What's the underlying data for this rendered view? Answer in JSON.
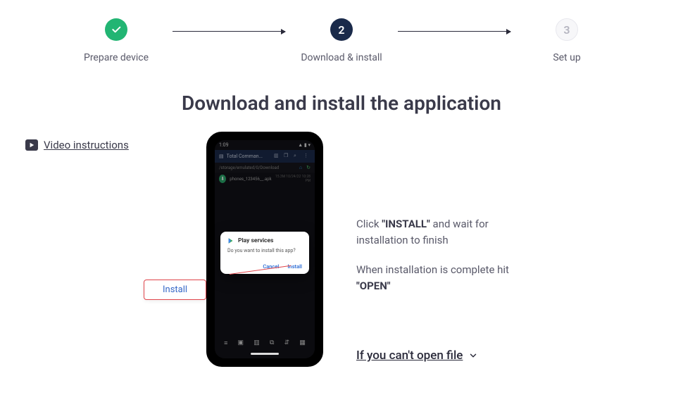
{
  "stepper": {
    "steps": [
      {
        "label": "Prepare device",
        "state": "done"
      },
      {
        "num": "2",
        "label": "Download & install",
        "state": "active"
      },
      {
        "num": "3",
        "label": "Set up",
        "state": "pending"
      }
    ]
  },
  "title": "Download and install the application",
  "video_link_label": "Video instructions",
  "phone": {
    "time": "1:09",
    "app_title": "Total Comman...",
    "path": "/storage/emulated/0/Download",
    "file": {
      "name": "phones_123456__.apk",
      "meta": "15.3M 10/24/22 10:28 PM"
    },
    "popup": {
      "title": "Play services",
      "message": "Do you want to install this app?",
      "cancel": "Cancel",
      "install": "Install"
    }
  },
  "callout_label": "Install",
  "instructions": {
    "p1_pre": "Click ",
    "p1_bold": "\"INSTALL\"",
    "p1_post": " and wait for installation to finish",
    "p2_pre": "When installation is complete hit ",
    "p2_bold": "\"OPEN\""
  },
  "open_file_label": "If you can't open file"
}
